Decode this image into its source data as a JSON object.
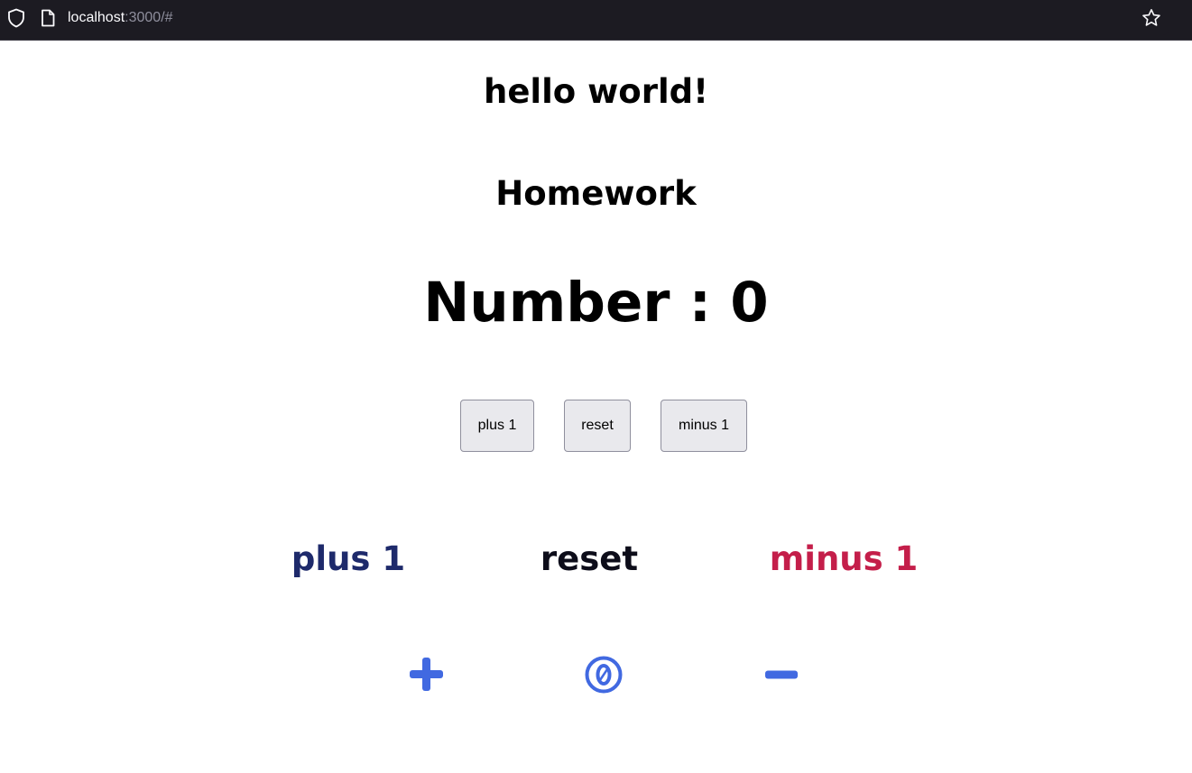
{
  "browser": {
    "url_host": "localhost",
    "url_rest": ":3000/#"
  },
  "page": {
    "greeting": "hello world!",
    "section_title": "Homework",
    "number_label": "Number : 0"
  },
  "native_buttons": {
    "plus_label": "plus 1",
    "reset_label": "reset",
    "minus_label": "minus 1"
  },
  "text_actions": {
    "plus_label": "plus 1",
    "reset_label": "reset",
    "minus_label": "minus 1"
  },
  "icon_actions": {
    "plus_icon": "plus-icon",
    "reset_icon": "zero-circle-icon",
    "minus_icon": "minus-icon"
  },
  "colors": {
    "plus_text": "#1e2a6b",
    "reset_text": "#0d0d1a",
    "minus_text": "#c41e4a",
    "icon_blue": "#4169e1"
  }
}
